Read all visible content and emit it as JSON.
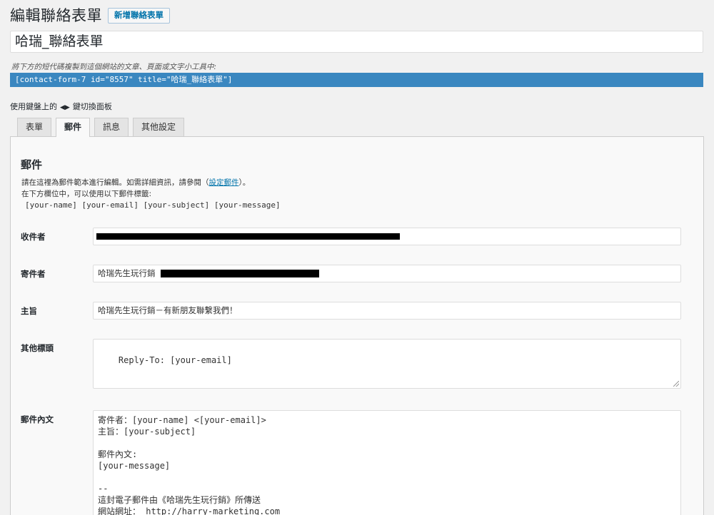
{
  "header": {
    "title": "編輯聯絡表單",
    "add_new": "新增聯絡表單"
  },
  "form_title": "哈瑞_聯絡表單",
  "shortcode": {
    "hint": "將下方的短代碼複製到這個網站的文章、頁面或文字小工具中:",
    "value": "[contact-form-7 id=\"8557\" title=\"哈瑞_聯絡表單\"]"
  },
  "keyboard_hint": {
    "before": "使用鍵盤上的",
    "arrows": "◀▶",
    "after": "鍵切換面板"
  },
  "tabs": [
    {
      "label": "表單",
      "active": false
    },
    {
      "label": "郵件",
      "active": true
    },
    {
      "label": "訊息",
      "active": false
    },
    {
      "label": "其他設定",
      "active": false
    }
  ],
  "mail_panel": {
    "heading": "郵件",
    "desc_line1_before": "請在這裡為郵件範本進行編輯。如需詳細資訊，請參閱（",
    "desc_link": "設定郵件",
    "desc_line1_after": "）。",
    "desc_line2": "在下方欄位中，可以使用以下郵件標籤:",
    "mail_tags": "[your-name] [your-email] [your-subject] [your-message]",
    "fields": {
      "to": {
        "label": "收件者",
        "value": ""
      },
      "from": {
        "label": "寄件者",
        "value": "哈瑞先生玩行銷"
      },
      "subject": {
        "label": "主旨",
        "value": "哈瑞先生玩行銷－有新朋友聯繫我們！"
      },
      "additional_headers": {
        "label": "其他標頭",
        "value": "Reply-To: [your-email]"
      },
      "body": {
        "label": "郵件內文",
        "value": "寄件者：[your-name] <[your-email]>\n主旨：[your-subject]\n\n郵件內文:\n[your-message]\n\n--\n這封電子郵件由《哈瑞先生玩行銷》所傳送\n網站網址： http://harry-marketing.com"
      }
    }
  }
}
